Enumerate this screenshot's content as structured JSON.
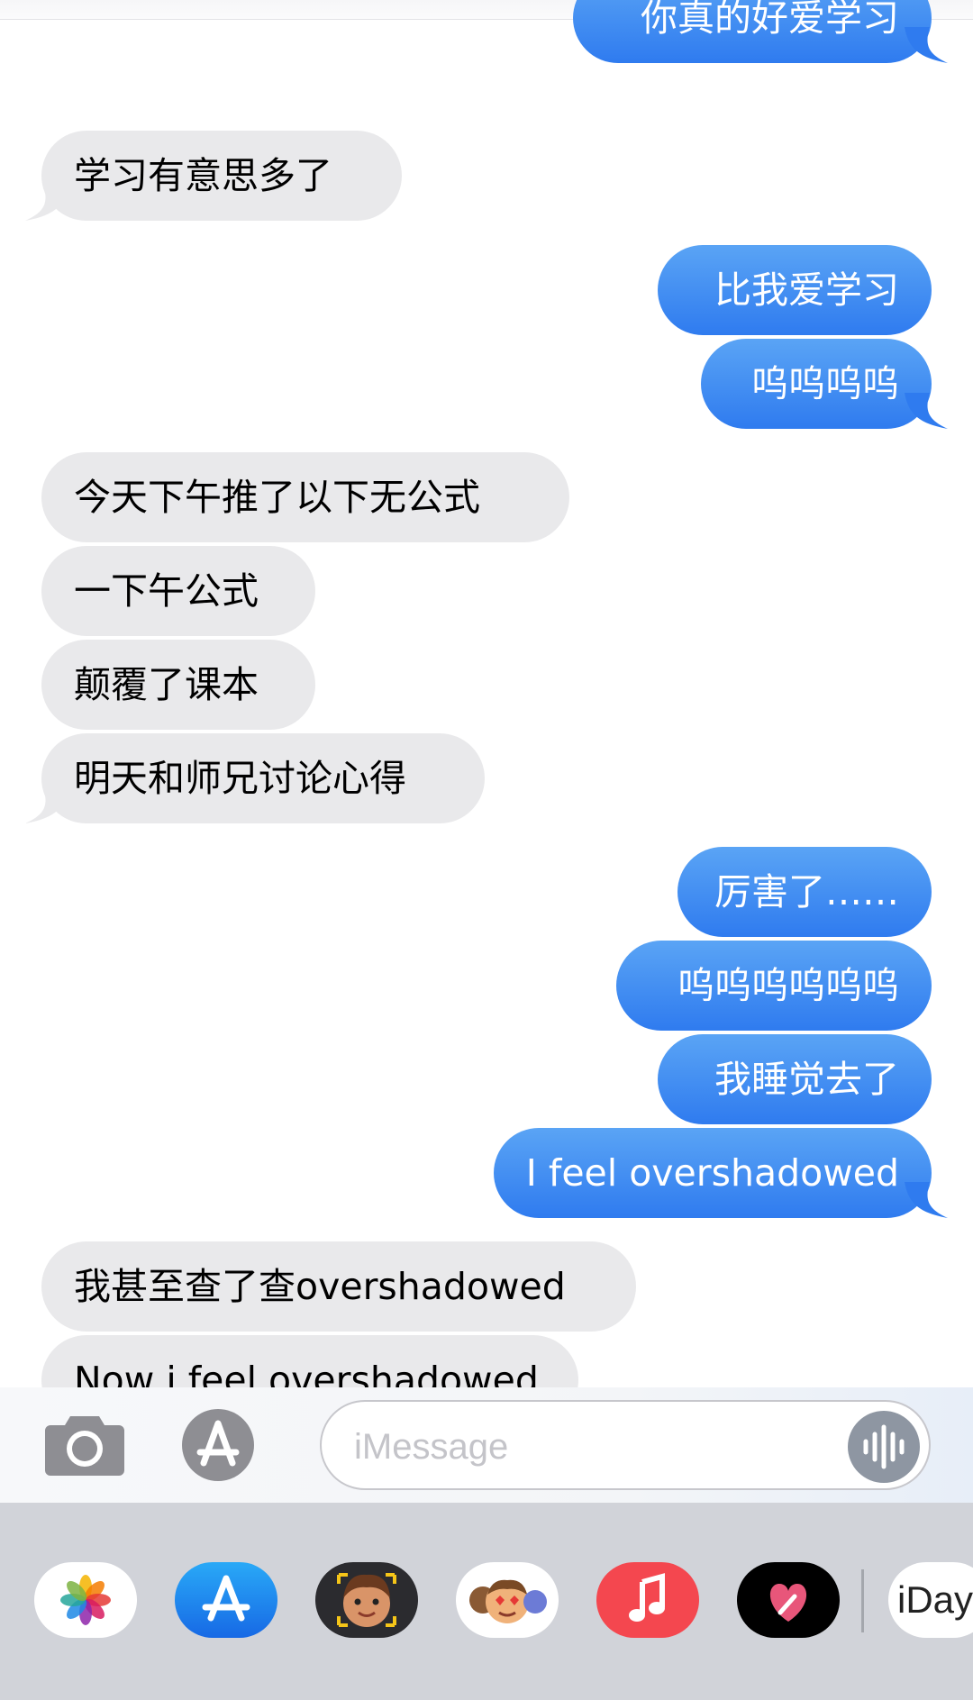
{
  "messages": [
    {
      "dir": "out",
      "text": "你真的好爱学习"
    },
    {
      "dir": "in",
      "text": "学习有意思多了"
    },
    {
      "dir": "out",
      "text": "比我爱学习"
    },
    {
      "dir": "out",
      "text": "呜呜呜呜"
    },
    {
      "dir": "in",
      "text": "今天下午推了以下无公式"
    },
    {
      "dir": "in",
      "text": "一下午公式"
    },
    {
      "dir": "in",
      "text": "颠覆了课本"
    },
    {
      "dir": "in",
      "text": "明天和师兄讨论心得"
    },
    {
      "dir": "out",
      "text": "厉害了……"
    },
    {
      "dir": "out",
      "text": "呜呜呜呜呜呜"
    },
    {
      "dir": "out",
      "text": "我睡觉去了"
    },
    {
      "dir": "out",
      "text": "I feel overshadowed"
    },
    {
      "dir": "in",
      "text": "我甚至查了查overshadowed"
    },
    {
      "dir": "in",
      "text": "Now i feel overshadowed"
    }
  ],
  "compose": {
    "placeholder": "iMessage",
    "camera_icon": "camera-icon",
    "apps_icon": "app-store-icon",
    "audio_icon": "audio-waveform-icon"
  },
  "app_drawer": {
    "apps": [
      {
        "name": "photos",
        "icon": "photos-icon"
      },
      {
        "name": "app-store",
        "icon": "app-store-icon"
      },
      {
        "name": "memoji-stickers",
        "icon": "memoji-icon"
      },
      {
        "name": "animoji",
        "icon": "animoji-icon"
      },
      {
        "name": "music",
        "icon": "music-icon"
      },
      {
        "name": "digital-touch",
        "icon": "heart-icon"
      },
      {
        "name": "iday",
        "icon": "iday-icon",
        "label": "iDay"
      }
    ]
  },
  "colors": {
    "incoming_bubble": "#e9e9eb",
    "outgoing_bubble_top": "#5aa4f5",
    "outgoing_bubble_bottom": "#2f7bef",
    "drawer_background": "#d1d3d9"
  }
}
